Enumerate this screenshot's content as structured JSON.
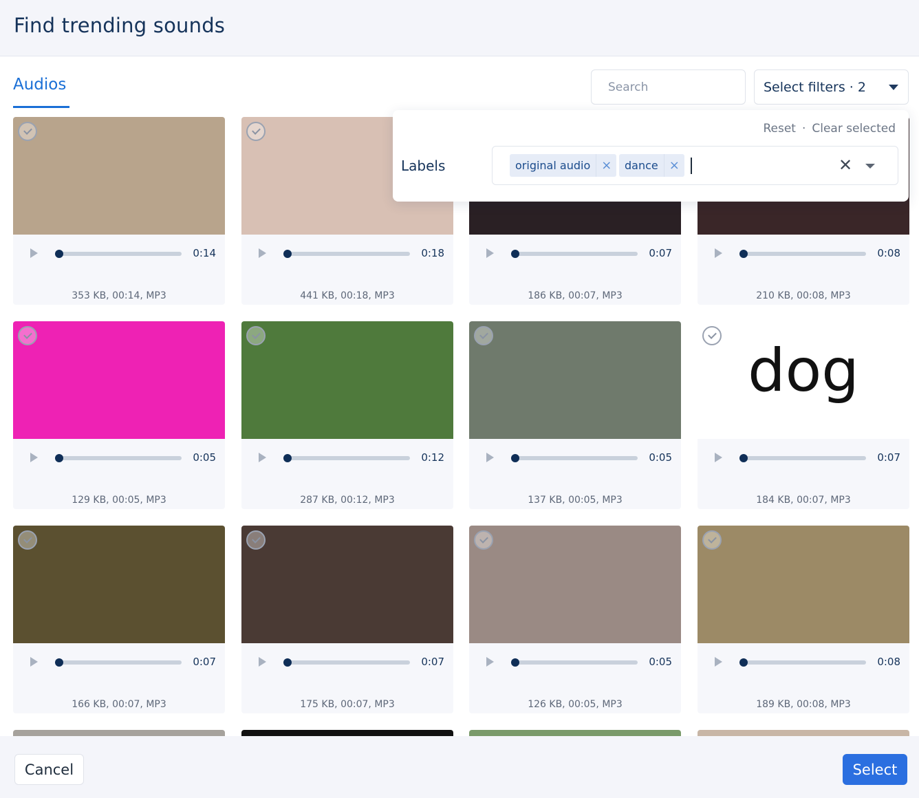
{
  "header": {
    "title": "Find trending sounds"
  },
  "tabs": [
    {
      "label": "Audios",
      "active": true
    }
  ],
  "search": {
    "placeholder": "Search",
    "value": ""
  },
  "filters": {
    "label": "Select filters · 2"
  },
  "filter_panel": {
    "reset_label": "Reset",
    "separator": "·",
    "clear_label": "Clear selected",
    "labels_title": "Labels",
    "chips": [
      {
        "label": "original audio"
      },
      {
        "label": "dance"
      }
    ],
    "chip_remove_glyph": "×",
    "clear_glyph": "✕"
  },
  "cards": [
    {
      "duration": "0:14",
      "meta": "353 KB, 00:14, MP3",
      "progress": 0,
      "thumb_color": "#b8a48c"
    },
    {
      "duration": "0:18",
      "meta": "441 KB, 00:18, MP3",
      "progress": 0,
      "thumb_color": "#d8c0b4"
    },
    {
      "duration": "0:07",
      "meta": "186 KB, 00:07, MP3",
      "progress": 0,
      "thumb_color": "#2a2024"
    },
    {
      "duration": "0:08",
      "meta": "210 KB, 00:08, MP3",
      "progress": 0,
      "thumb_color": "#3a2628"
    },
    {
      "duration": "0:05",
      "meta": "129 KB, 00:05, MP3",
      "progress": 0,
      "thumb_color": "#ee22b4"
    },
    {
      "duration": "0:12",
      "meta": "287 KB, 00:12, MP3",
      "progress": 0,
      "thumb_color": "#4f7a3c"
    },
    {
      "duration": "0:05",
      "meta": "137 KB, 00:05, MP3",
      "progress": 0,
      "thumb_color": "#6f7a6c"
    },
    {
      "duration": "0:07",
      "meta": "184 KB, 00:07, MP3",
      "progress": 0,
      "thumb_color": "#ffffff",
      "thumb_text": "dog"
    },
    {
      "duration": "0:07",
      "meta": "166 KB, 00:07, MP3",
      "progress": 0,
      "thumb_color": "#5b5030"
    },
    {
      "duration": "0:07",
      "meta": "175 KB, 00:07, MP3",
      "progress": 0,
      "thumb_color": "#4a3a34"
    },
    {
      "duration": "0:05",
      "meta": "126 KB, 00:05, MP3",
      "progress": 0,
      "thumb_color": "#9a8a84"
    },
    {
      "duration": "0:08",
      "meta": "189 KB, 00:08, MP3",
      "progress": 0,
      "thumb_color": "#9c8a66"
    }
  ],
  "peek_colors": [
    "#a6a29c",
    "#111111",
    "#7a9a6a",
    "#c8b6a6"
  ],
  "footer": {
    "cancel_label": "Cancel",
    "select_label": "Select"
  },
  "colors": {
    "accent": "#2b6fe0",
    "title": "#15335a",
    "tab_active": "#1a6fd6"
  }
}
